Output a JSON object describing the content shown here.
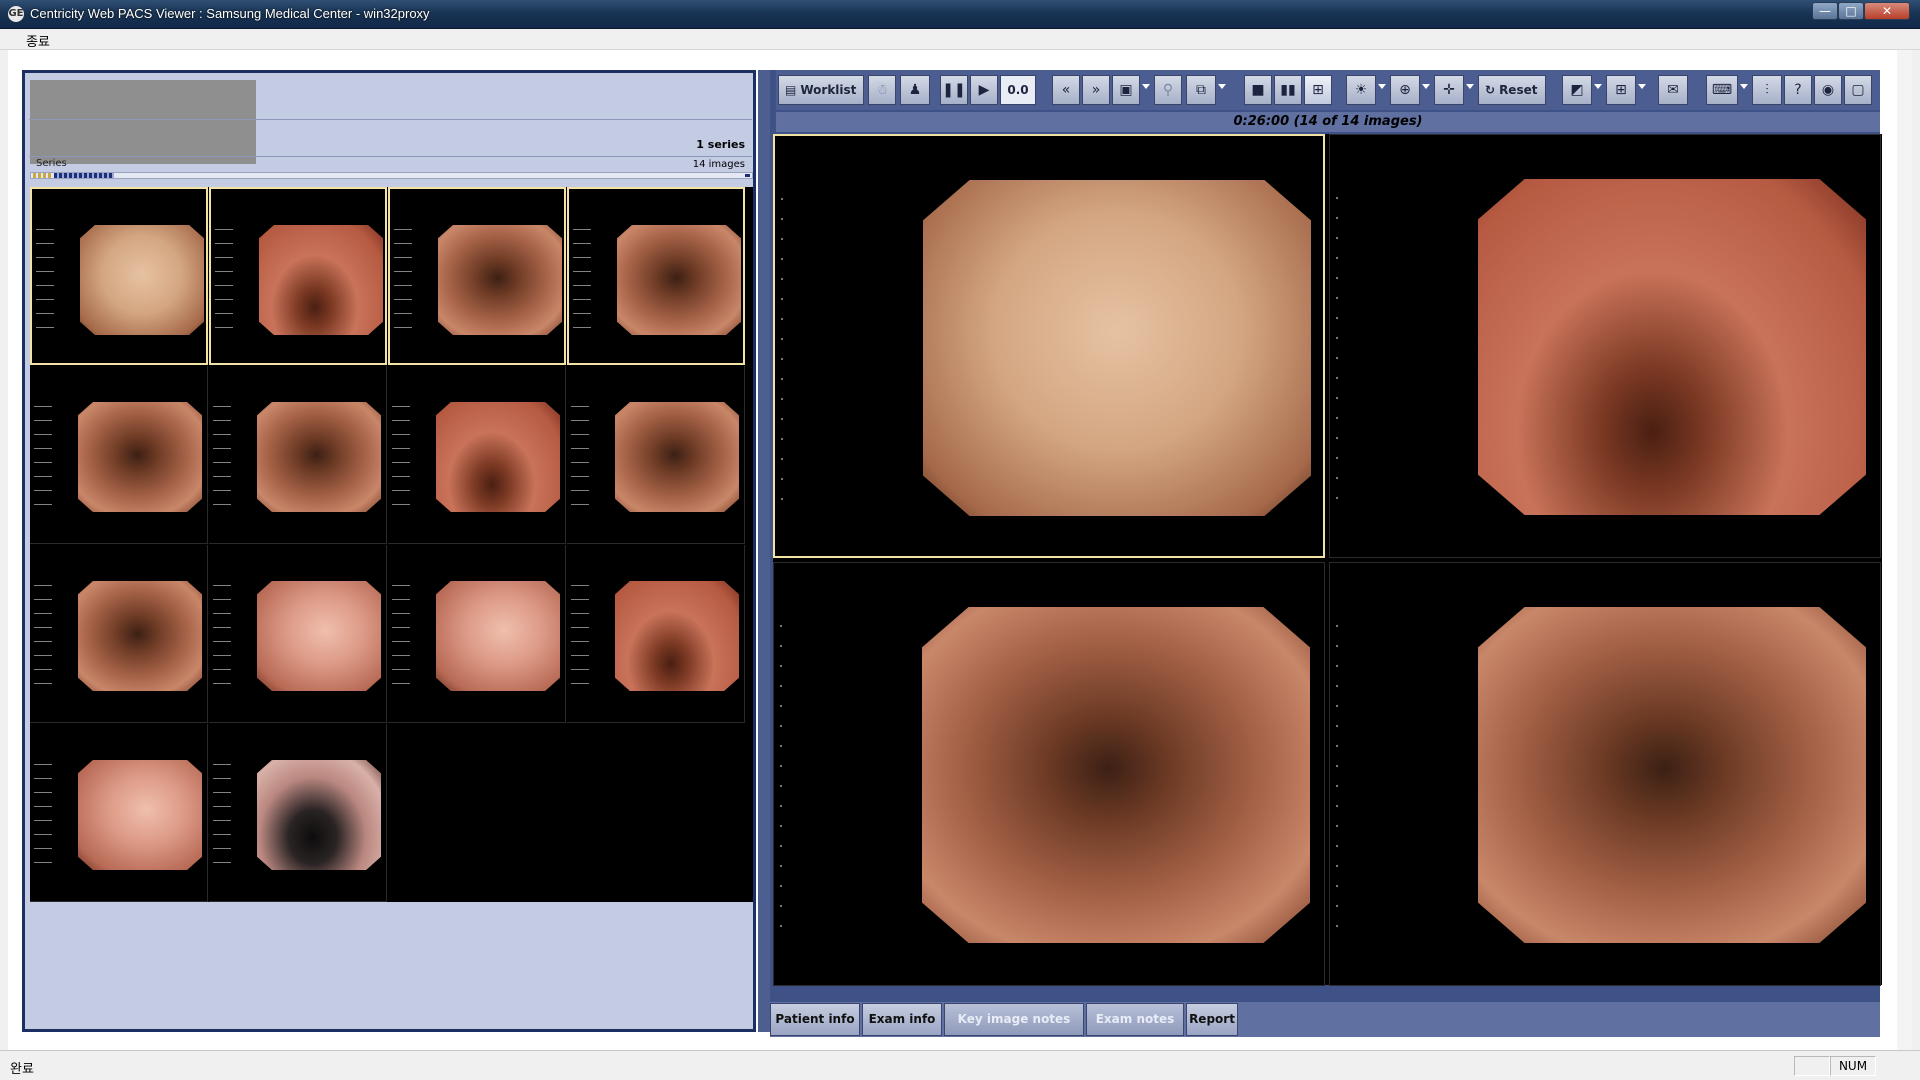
{
  "window": {
    "title": "Centricity Web PACS Viewer : Samsung Medical Center - win32proxy",
    "controls": [
      "—",
      "□",
      "✕"
    ]
  },
  "menu": {
    "items": [
      "종료"
    ]
  },
  "left_panel": {
    "series_count": "1 series",
    "series_label": "Series",
    "image_count": "14 images",
    "thumbnails": [
      {
        "selected": true,
        "tone": "pale"
      },
      {
        "selected": true,
        "tone": "red"
      },
      {
        "selected": true,
        "tone": "brown"
      },
      {
        "selected": true,
        "tone": "brown"
      },
      {
        "selected": false,
        "tone": "brown"
      },
      {
        "selected": false,
        "tone": "brown"
      },
      {
        "selected": false,
        "tone": "red"
      },
      {
        "selected": false,
        "tone": "brown"
      },
      {
        "selected": false,
        "tone": "brown"
      },
      {
        "selected": false,
        "tone": "pink"
      },
      {
        "selected": false,
        "tone": "pink"
      },
      {
        "selected": false,
        "tone": "red"
      },
      {
        "selected": false,
        "tone": "pink"
      },
      {
        "selected": false,
        "tone": "dark"
      }
    ]
  },
  "toolbar": {
    "worklist_label": "Worklist",
    "cine_speed": "0.0",
    "reset_label": "Reset"
  },
  "viewer": {
    "status": "0:26:00 (14 of 14 images)",
    "viewports": [
      {
        "selected": true,
        "tone": "pale"
      },
      {
        "selected": false,
        "tone": "red"
      },
      {
        "selected": false,
        "tone": "brown"
      },
      {
        "selected": false,
        "tone": "brown"
      }
    ]
  },
  "tabs": [
    "Patient info",
    "Exam info",
    "Key image notes",
    "Exam notes",
    "Report"
  ],
  "statusbar": {
    "text": "완료",
    "num": "NUM"
  }
}
